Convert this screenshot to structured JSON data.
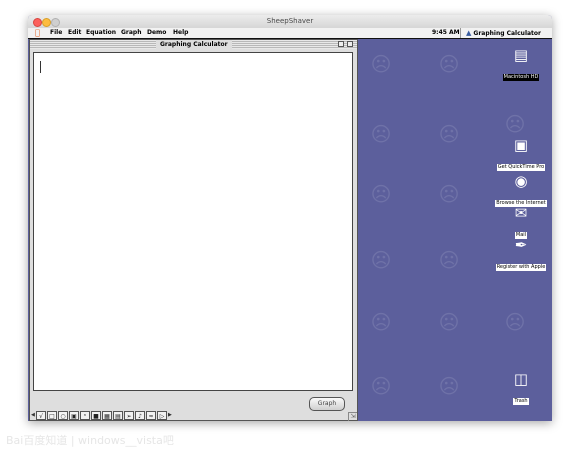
{
  "window": {
    "title": "SheepShaver"
  },
  "menubar": {
    "items": [
      "File",
      "Edit",
      "Equation",
      "Graph",
      "Demo",
      "Help"
    ],
    "clock": "9:45 AM",
    "active_app": "Graphing Calculator"
  },
  "calculator_window": {
    "title": "Graphing Calculator",
    "equation_text": "",
    "graph_button": "Graph",
    "palette_icons": [
      "sqrt-icon",
      "fraction-icon",
      "circle-icon",
      "parenthesis-icon",
      "power-icon",
      "abs-icon",
      "matrix-icon",
      "table-icon",
      "arrow-icon",
      "sound-icon",
      "compare-icon",
      "end-icon"
    ]
  },
  "desktop": {
    "icons": [
      {
        "label": "Macintosh HD",
        "icon": "hard-disk-icon",
        "dark": true
      },
      {
        "label": "Get QuickTime Pro",
        "icon": "quicktime-icon",
        "dark": false
      },
      {
        "label": "Browse the Internet",
        "icon": "internet-icon",
        "dark": false
      },
      {
        "label": "Mail",
        "icon": "mail-icon",
        "dark": false
      },
      {
        "label": "Register with Apple",
        "icon": "register-icon",
        "dark": false
      },
      {
        "label": "Trash",
        "icon": "trash-icon",
        "dark": false
      }
    ]
  },
  "watermark": "Bai百度知道 | windows__vista吧"
}
